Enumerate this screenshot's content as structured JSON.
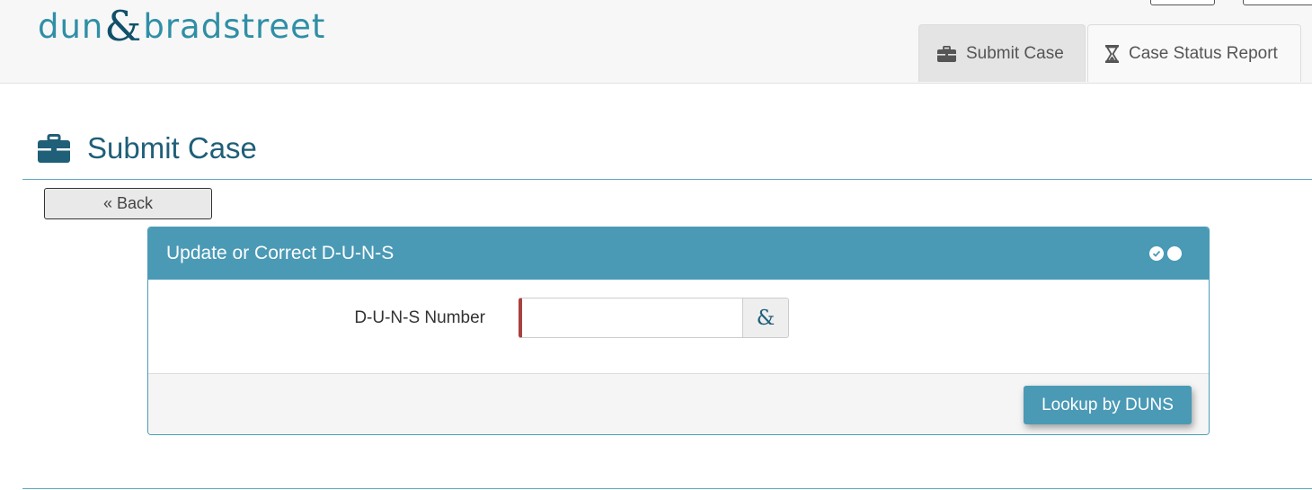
{
  "brand": {
    "name_left": "dun",
    "ampersand": "&",
    "name_right": "bradstreet"
  },
  "tabs": [
    {
      "label": "Submit Case",
      "icon": "briefcase-icon",
      "active": true
    },
    {
      "label": "Case Status Report",
      "icon": "hourglass-icon",
      "active": false
    }
  ],
  "page": {
    "title": "Submit Case",
    "title_icon": "briefcase-icon",
    "back_label": "« Back"
  },
  "panel": {
    "title": "Update or Correct D-U-N-S",
    "step_icons": [
      "check-circle-icon",
      "dot-circle-icon"
    ],
    "field": {
      "label": "D-U-N-S Number",
      "value": "",
      "addon": "&"
    },
    "submit_label": "Lookup by DUNS"
  },
  "colors": {
    "brand_teal": "#2f8fa6",
    "brand_dark": "#11506a",
    "panel_header": "#4a9ab6",
    "required_marker": "#a9413f",
    "title_text": "#1f5f78"
  }
}
